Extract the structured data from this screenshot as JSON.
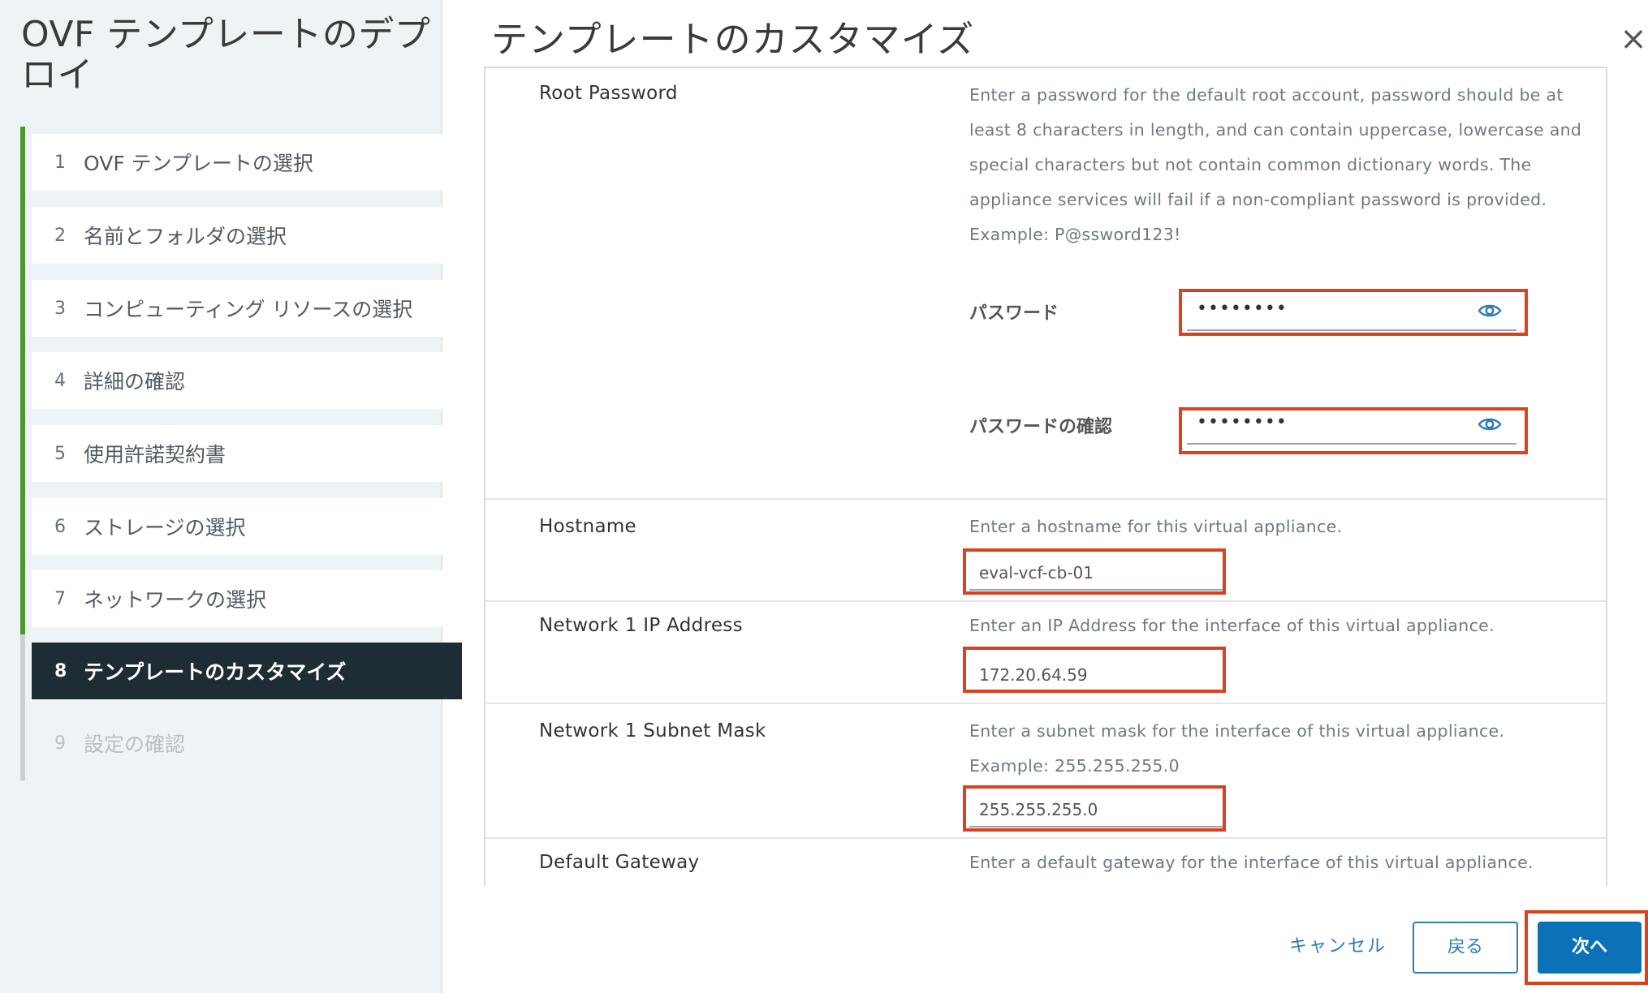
{
  "sidebar": {
    "title": "OVF テンプレートのデプロイ",
    "steps": [
      {
        "num": "1",
        "label": "OVF テンプレートの選択",
        "state": "done"
      },
      {
        "num": "2",
        "label": "名前とフォルダの選択",
        "state": "done"
      },
      {
        "num": "3",
        "label": "コンピューティング リソースの選択",
        "state": "done"
      },
      {
        "num": "4",
        "label": "詳細の確認",
        "state": "done"
      },
      {
        "num": "5",
        "label": "使用許諾契約書",
        "state": "done"
      },
      {
        "num": "6",
        "label": "ストレージの選択",
        "state": "done"
      },
      {
        "num": "7",
        "label": "ネットワークの選択",
        "state": "done"
      },
      {
        "num": "8",
        "label": "テンプレートのカスタマイズ",
        "state": "active"
      },
      {
        "num": "9",
        "label": "設定の確認",
        "state": "disabled"
      }
    ]
  },
  "main": {
    "title": "テンプレートのカスタマイズ",
    "close_icon": "close-icon"
  },
  "properties": {
    "root_password": {
      "label": "Root Password",
      "description": "Enter a password for the default root account, password should be at least 8 characters in length, and can contain uppercase, lowercase and special characters but not contain common dictionary words. The appliance services will fail if a non-compliant password is provided. Example: P@ssword123!",
      "password_label": "パスワード",
      "password_value": "••••••••",
      "confirm_label": "パスワードの確認",
      "confirm_value": "••••••••"
    },
    "hostname": {
      "label": "Hostname",
      "description": "Enter a hostname for this virtual appliance.",
      "value": "eval-vcf-cb-01"
    },
    "ip_address": {
      "label": "Network 1 IP Address",
      "description": "Enter an IP Address for the interface of this virtual appliance.",
      "value": "172.20.64.59"
    },
    "subnet_mask": {
      "label": "Network 1 Subnet Mask",
      "description": "Enter a subnet mask for the interface of this virtual appliance. Example: 255.255.255.0",
      "value": "255.255.255.0"
    },
    "gateway": {
      "label": "Default Gateway",
      "description": "Enter a default gateway for the interface of this virtual appliance."
    }
  },
  "footer": {
    "cancel_label": "キャンセル",
    "back_label": "戻る",
    "next_label": "次へ"
  },
  "colors": {
    "accent": "#0b72b8",
    "highlight": "#d9421d",
    "progress": "#4a9b2e",
    "active_step": "#1e2c33"
  }
}
